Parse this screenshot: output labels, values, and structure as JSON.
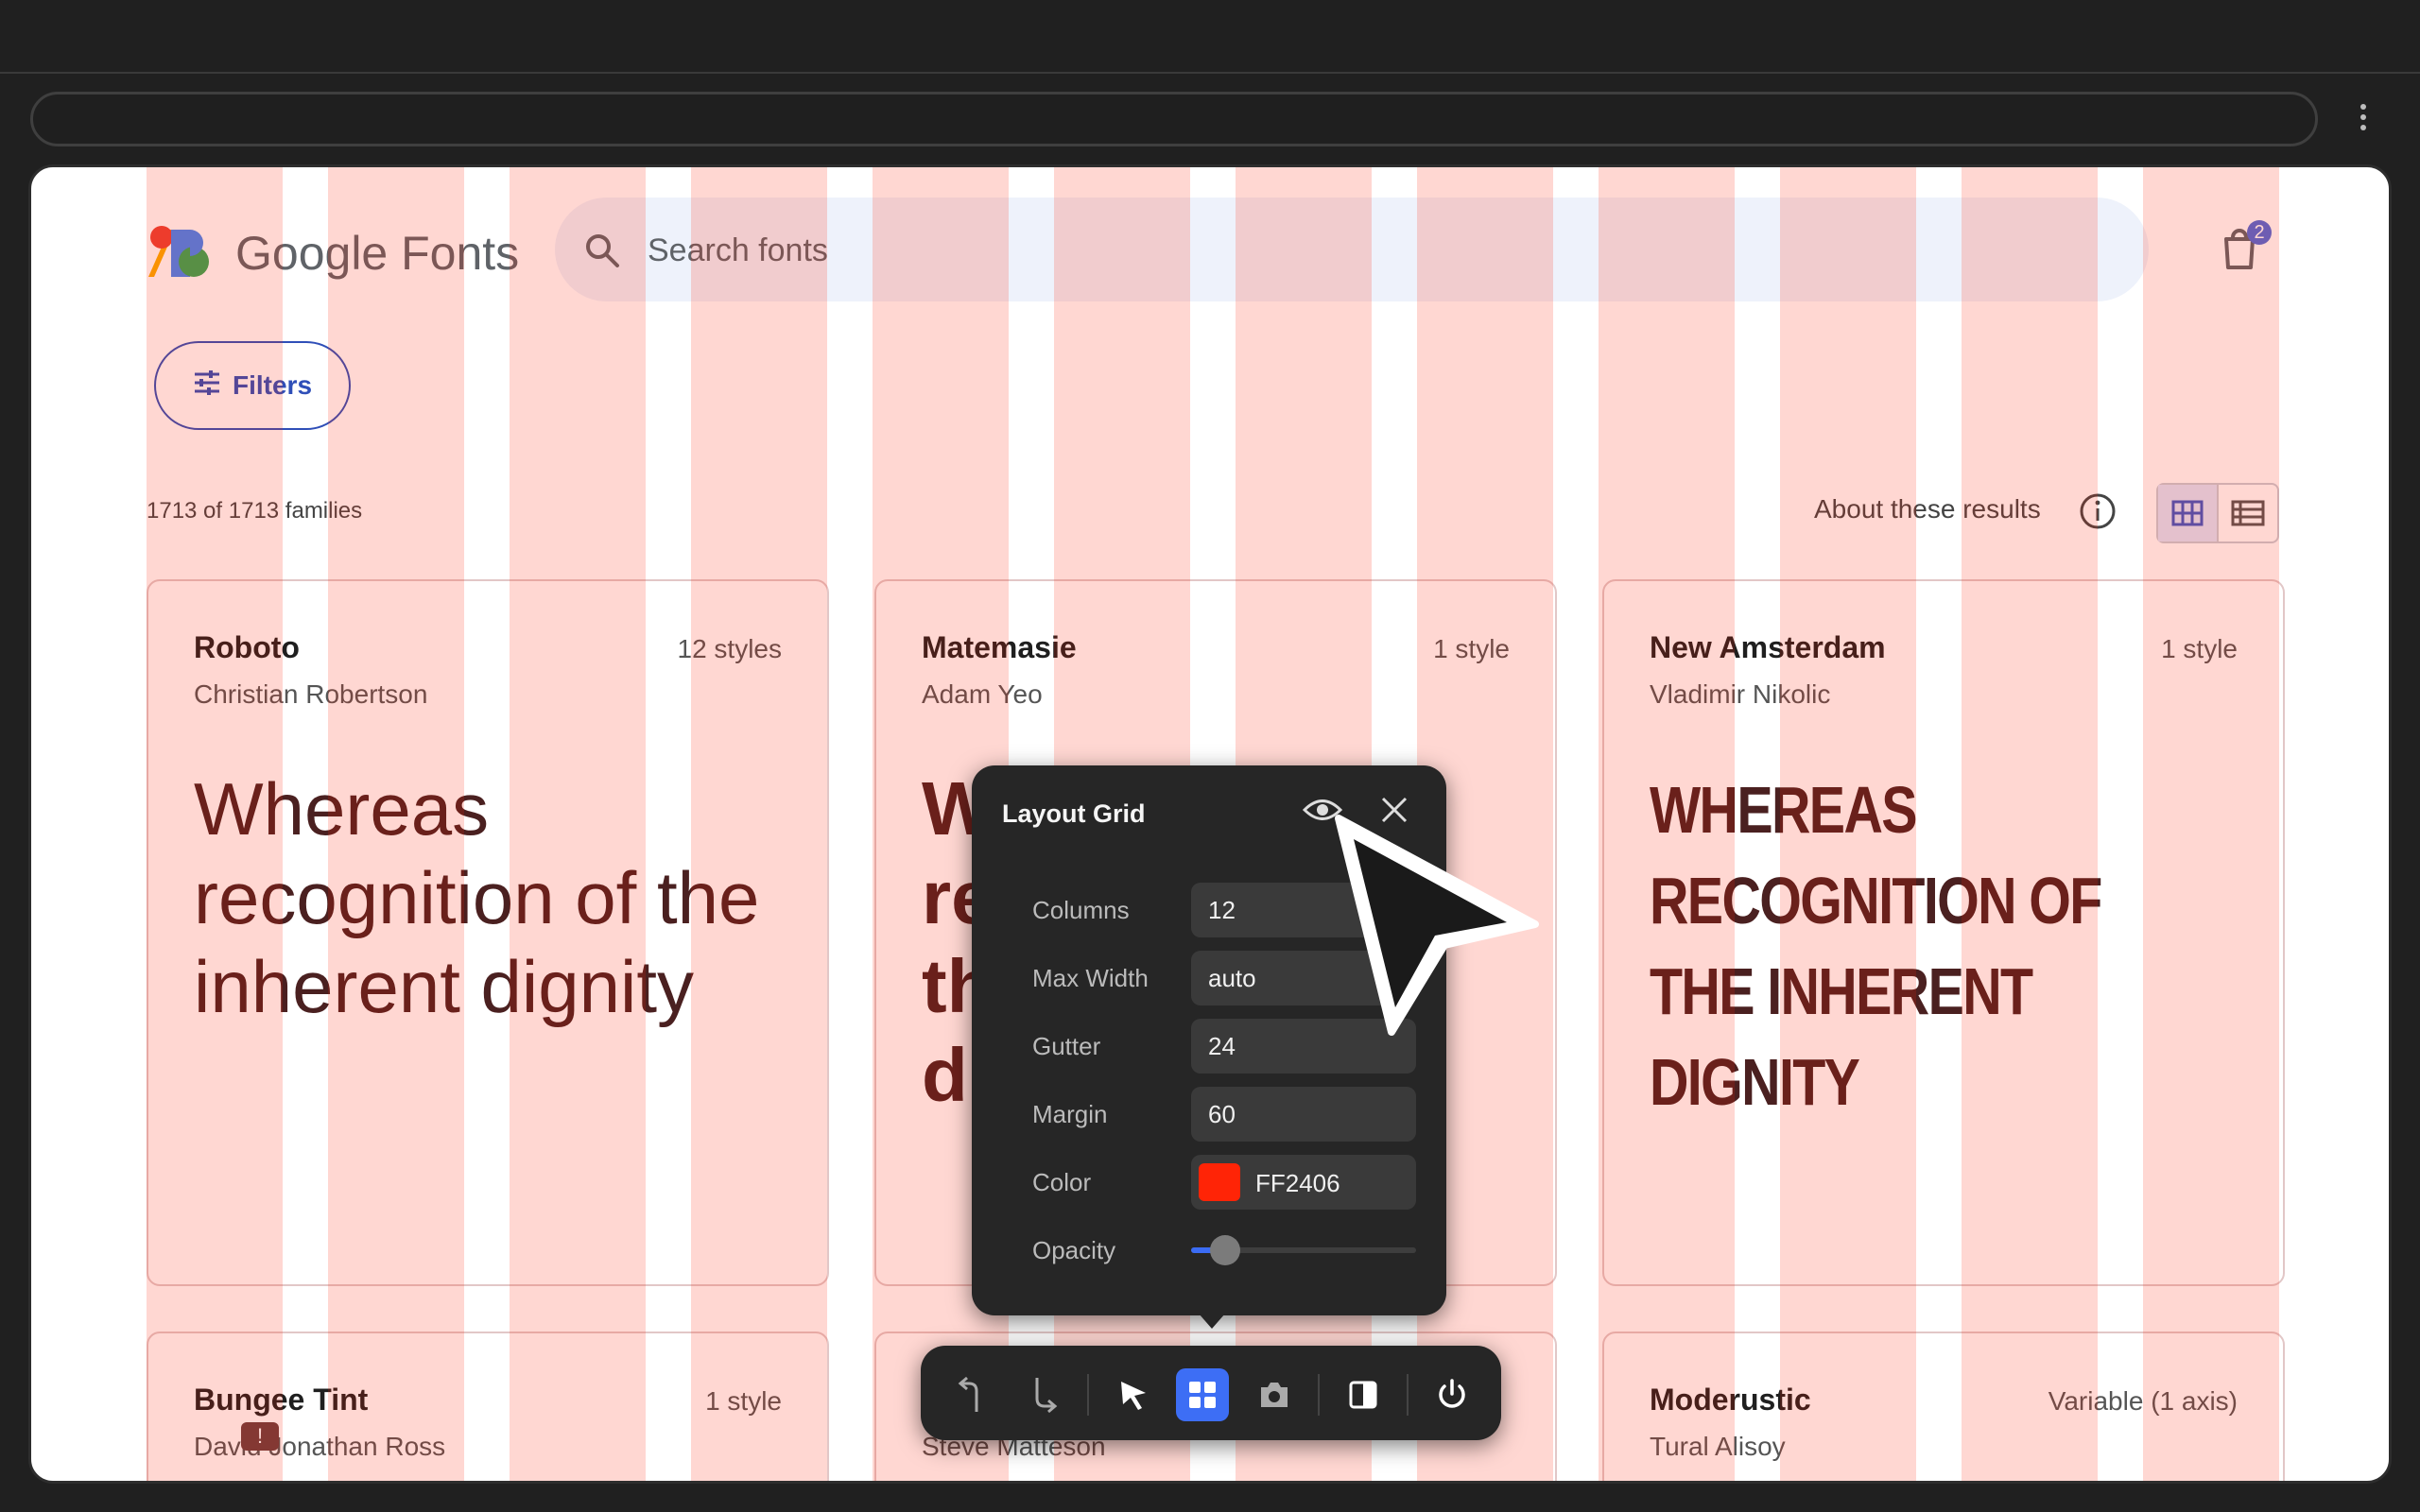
{
  "header": {
    "logo_text": "Google Fonts",
    "search_placeholder": "Search fonts",
    "cart_count": "2"
  },
  "filters_label": "Filters",
  "results": {
    "count_text": "1713 of 1713 families",
    "about_text": "About these results"
  },
  "cards": [
    {
      "name": "Roboto",
      "styles": "12 styles",
      "author": "Christian Robertson",
      "sample": "Whereas recognition of the inherent dignity"
    },
    {
      "name": "Matemasie",
      "styles": "1 style",
      "author": "Adam Yeo",
      "sample": "W\nre\nth\ndi"
    },
    {
      "name": "New Amsterdam",
      "styles": "1 style",
      "author": "Vladimir Nikolic",
      "sample": "Whereas recognition of the inherent dignity"
    },
    {
      "name": "Bungee Tint",
      "styles": "1 style",
      "author": "David Jonathan Ross"
    },
    {
      "name": "",
      "styles": "",
      "author": "Steve Matteson"
    },
    {
      "name": "Moderustic",
      "styles": "Variable (1 axis)",
      "author": "Tural Alisoy"
    }
  ],
  "layout_grid_panel": {
    "title": "Layout Grid",
    "columns_label": "Columns",
    "columns_value": "12",
    "max_width_label": "Max Width",
    "max_width_value": "auto",
    "gutter_label": "Gutter",
    "gutter_value": "24",
    "margin_label": "Margin",
    "margin_value": "60",
    "color_label": "Color",
    "color_value": "FF2406",
    "opacity_label": "Opacity",
    "opacity_level": 0.1
  },
  "colors": {
    "grid_color": "#FF2406",
    "accent": "#3d6ef5",
    "filters_blue": "#2f4fb8"
  },
  "icons": {
    "toolbar": [
      "undo-icon",
      "redo-icon",
      "select-cursor-icon",
      "layout-grid-icon",
      "camera-icon",
      "contrast-icon",
      "power-icon"
    ]
  },
  "error_badge": "!"
}
